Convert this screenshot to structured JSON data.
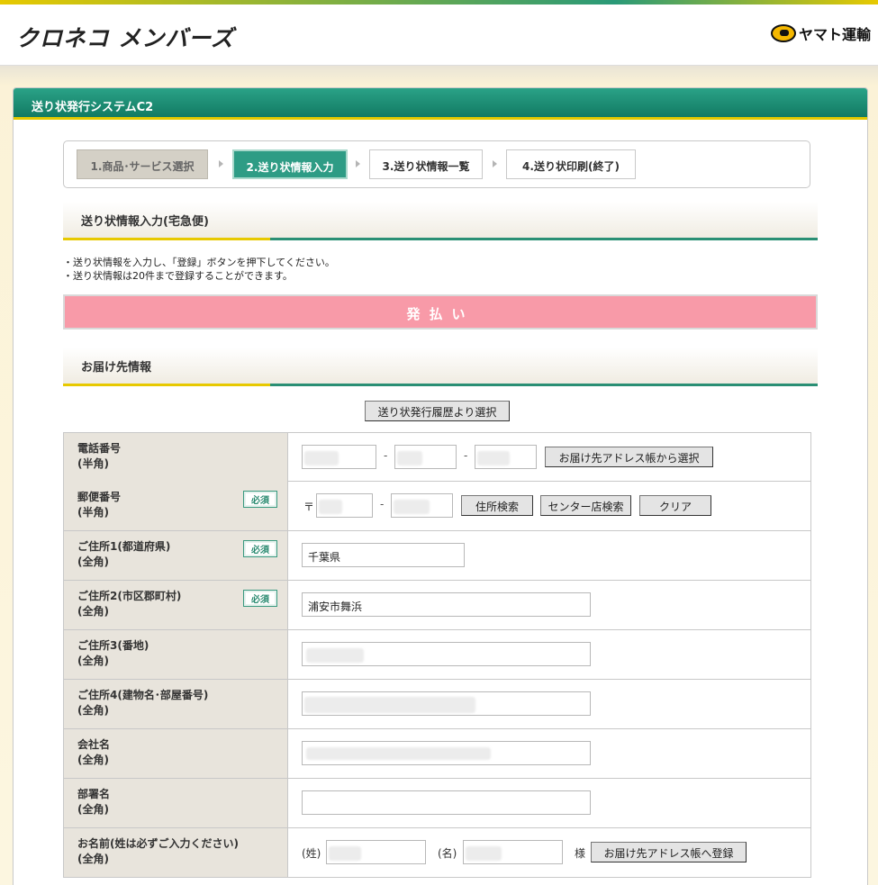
{
  "header": {
    "logo_text": "クロネコ メンバーズ",
    "brand_text": "ヤマト運輸"
  },
  "panel": {
    "title": "送り状発行システムC2"
  },
  "steps": [
    {
      "label": "1.商品･サービス選択",
      "state": "done"
    },
    {
      "label": "2.送り状情報入力",
      "state": "active"
    },
    {
      "label": "3.送り状情報一覧",
      "state": "todo"
    },
    {
      "label": "4.送り状印刷(終了)",
      "state": "todo"
    }
  ],
  "section1": {
    "title": "送り状情報入力(宅急便)"
  },
  "notes": [
    "・送り状情報を入力し、「登録」ボタンを押下してください。",
    "・送り状情報は20件まで登録することができます。"
  ],
  "payment": {
    "label": "発払い"
  },
  "section2": {
    "title": "お届け先情報"
  },
  "history_button": "送り状発行履歴より選択",
  "form": {
    "required_label": "必須",
    "phone": {
      "label1": "電話番号",
      "label2": "(半角)",
      "address_book_button": "お届け先アドレス帳から選択"
    },
    "postal": {
      "label1": "郵便番号",
      "label2": "(半角)",
      "mark": "〒",
      "search_button": "住所検索",
      "center_button": "センター店検索",
      "clear_button": "クリア"
    },
    "addr1": {
      "label1": "ご住所1(都道府県)",
      "label2": "(全角)",
      "value": "千葉県"
    },
    "addr2": {
      "label1": "ご住所2(市区郡町村)",
      "label2": "(全角)",
      "value": "浦安市舞浜"
    },
    "addr3": {
      "label1": "ご住所3(番地)",
      "label2": "(全角)"
    },
    "addr4": {
      "label1": "ご住所4(建物名･部屋番号)",
      "label2": "(全角)"
    },
    "company": {
      "label1": "会社名",
      "label2": "(全角)"
    },
    "dept": {
      "label1": "部署名",
      "label2": "(全角)"
    },
    "name": {
      "label1": "お名前(姓は必ずご入力ください)",
      "label2": "(全角)",
      "sei": "(姓)",
      "mei": "(名)",
      "sama": "様",
      "register_button": "お届け先アドレス帳へ登録"
    }
  },
  "icons": {
    "brand": "yamato-cat-icon"
  },
  "colors": {
    "accent_green": "#1a8a70",
    "accent_yellow": "#e7c900",
    "pay_pink": "#f89aa8"
  }
}
